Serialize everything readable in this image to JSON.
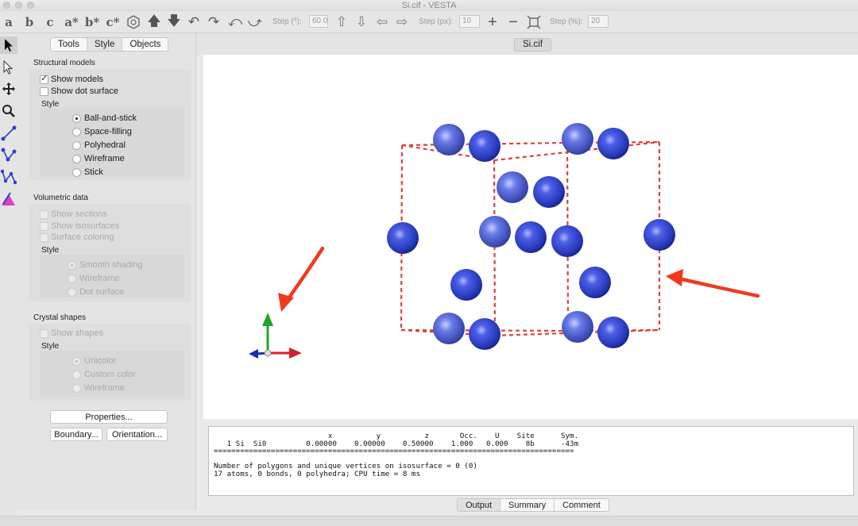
{
  "window": {
    "title": "Si.cif - VESTA"
  },
  "toolbar": {
    "letters": [
      "a",
      "b",
      "c",
      "a*",
      "b*",
      "c*"
    ],
    "step_deg_label": "Step (°):",
    "step_deg_value": "60.0",
    "step_px_label": "Step (px):",
    "step_px_value": "10",
    "step_pct_label": "Step (%):",
    "step_pct_value": "20"
  },
  "tools": [
    "select-icon",
    "hand-icon",
    "translate-icon",
    "magnifier-icon",
    "bond-length-icon",
    "bond-angle-icon",
    "dihedral-angle-icon",
    "edit-icon"
  ],
  "panel": {
    "tabs": [
      "Tools",
      "Style",
      "Objects"
    ],
    "selected_tab": "Style",
    "structural": {
      "title": "Structural models",
      "show_models": "Show models",
      "show_dot_surface": "Show dot surface",
      "style_label": "Style",
      "styles": [
        "Ball-and-stick",
        "Space-filling",
        "Polyhedral",
        "Wireframe",
        "Stick"
      ]
    },
    "volumetric": {
      "title": "Volumetric data",
      "show_sections": "Show sections",
      "show_isosurfaces": "Show isosurfaces",
      "surface_coloring": "Surface coloring",
      "style_label": "Style",
      "styles": [
        "Smooth shading",
        "Wireframe",
        "Dot surface"
      ]
    },
    "crystal": {
      "title": "Crystal shapes",
      "show_shapes": "Show shapes",
      "style_label": "Style",
      "styles": [
        "Unicolor",
        "Custom color",
        "Wireframe"
      ]
    },
    "buttons": {
      "properties": "Properties...",
      "boundary": "Boundary...",
      "orientation": "Orientation..."
    }
  },
  "view": {
    "file_tab": "Si.cif",
    "atom_color": "#2b3fd0",
    "cell_color": "#e04040",
    "arrow_color": "#ef3a1f"
  },
  "output": {
    "lines": [
      "                          x          y          z       Occ.    U    Site      Sym.",
      "   1 Si  Si0         0.00000    0.00000    0.50000    1.000   0.000    8b      -43m",
      "==================================================================================",
      "",
      "Number of polygons and unique vertices on isosurface = 0 (0)",
      "17 atoms, 0 bonds, 0 polyhedra; CPU time = 8 ms"
    ],
    "tabs": [
      "Output",
      "Summary",
      "Comment"
    ],
    "selected_tab": "Output"
  }
}
